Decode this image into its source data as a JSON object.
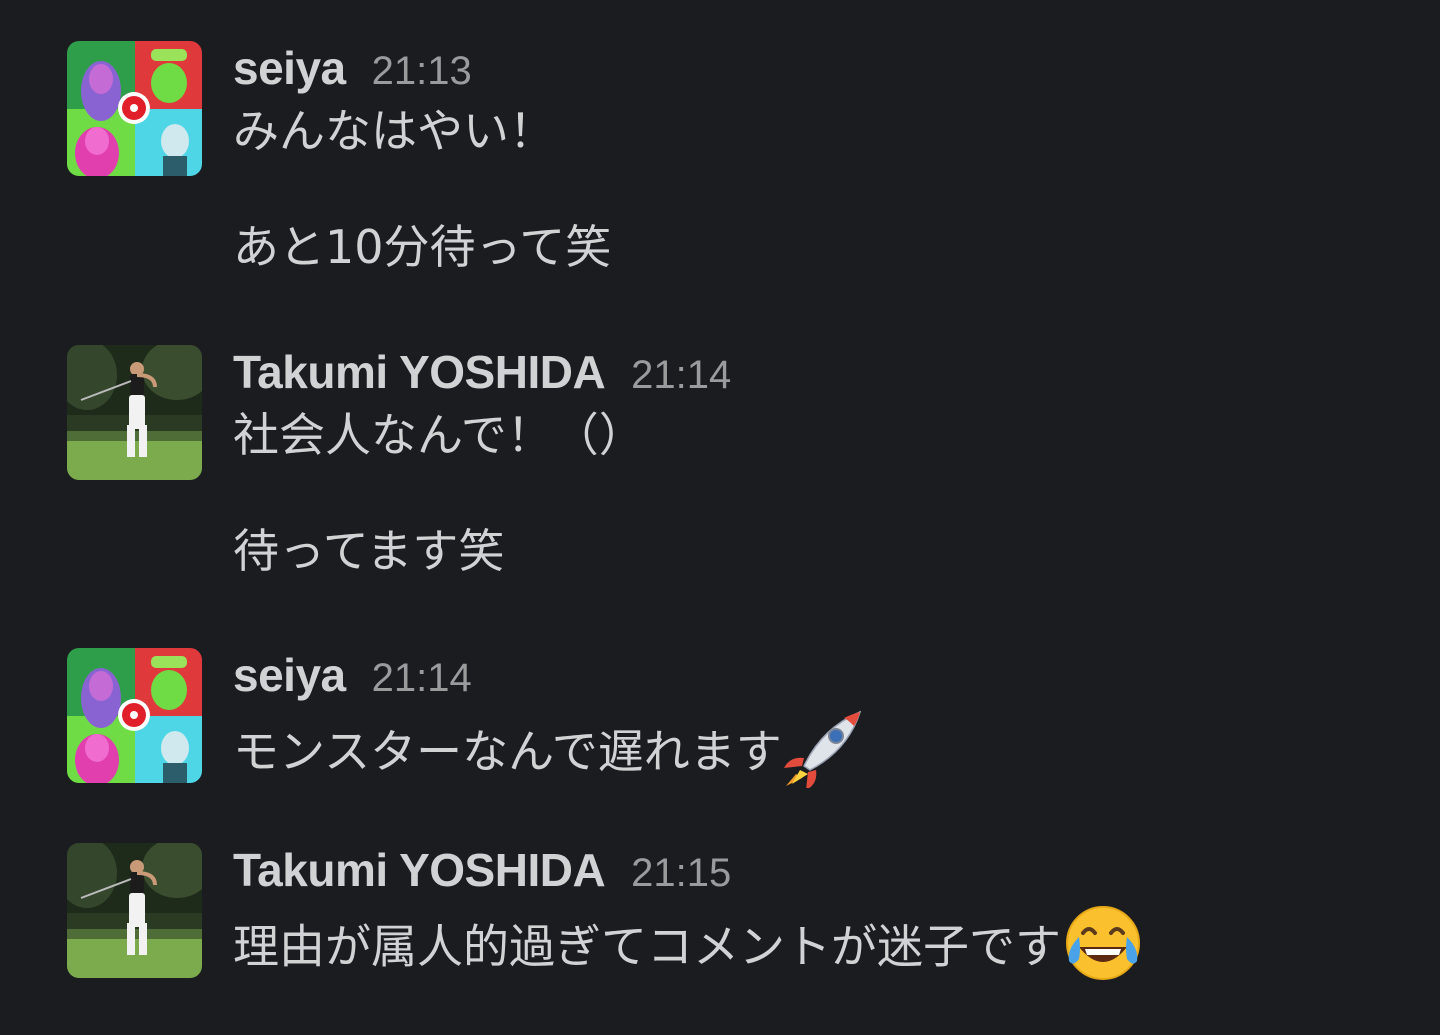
{
  "messages": [
    {
      "author": "seiya",
      "time": "21:13",
      "avatar": "popart-band-avatar",
      "lines": [
        "みんなはやい！",
        "あと10分待って笑"
      ]
    },
    {
      "author": "Takumi YOSHIDA",
      "time": "21:14",
      "avatar": "golfer-avatar",
      "lines": [
        "社会人なんで！（）",
        "待ってます笑"
      ]
    },
    {
      "author": "seiya",
      "time": "21:14",
      "avatar": "popart-band-avatar",
      "lines": [
        "モンスターなんで遅れます"
      ],
      "emoji": "rocket-icon"
    },
    {
      "author": "Takumi YOSHIDA",
      "time": "21:15",
      "avatar": "golfer-avatar",
      "lines": [
        "理由が属人的過ぎてコメントが迷子です"
      ],
      "emoji": "tears-of-joy-icon"
    }
  ],
  "colors": {
    "background": "#1b1c20",
    "text": "#d1d2d3",
    "timestamp": "#9a9b9d"
  }
}
